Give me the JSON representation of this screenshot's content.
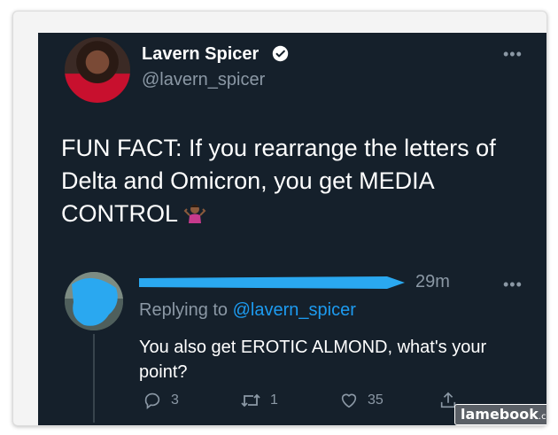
{
  "tweet": {
    "author_name": "Lavern Spicer",
    "handle": "@lavern_spicer",
    "text": "FUN FACT: If you rearrange the letters of Delta and Omicron, you get MEDIA CONTROL"
  },
  "reply": {
    "time": "29m",
    "replying_prefix": "Replying to",
    "replying_handle": "@lavern_spicer",
    "text": "You also get EROTIC ALMOND, what's your point?",
    "actions": {
      "reply_count": "3",
      "retweet_count": "1",
      "like_count": "35"
    }
  },
  "watermark": {
    "brand": "lamebook",
    "suffix": ".com"
  },
  "colors": {
    "background": "#15202b",
    "text": "#ffffff",
    "secondary": "#8b98a5",
    "link": "#1d9bf0",
    "redaction": "#2aa8f0"
  },
  "icons": [
    "verified-badge-icon",
    "more-icon",
    "reply-icon",
    "retweet-icon",
    "like-icon",
    "share-icon",
    "shrug-emoji-icon"
  ]
}
